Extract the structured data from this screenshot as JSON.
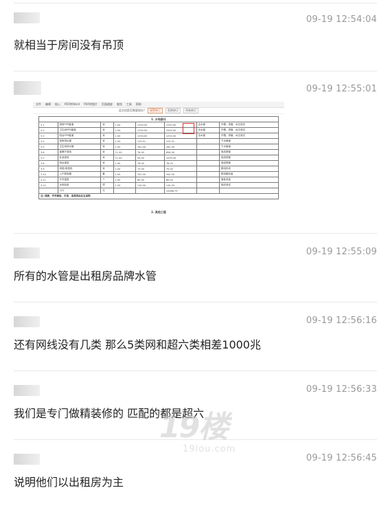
{
  "messages": [
    {
      "time": "09-19 12:54:04",
      "text": "就相当于房间没有吊顶"
    },
    {
      "time": "09-19 12:55:01",
      "text": ""
    },
    {
      "time": "09-19 12:55:09",
      "text": "所有的水管是出租房品牌水管"
    },
    {
      "time": "09-19 12:56:16",
      "text": "还有网线没有几类 那么5类网和超六类相差1000兆"
    },
    {
      "time": "09-19 12:56:33",
      "text": "我们是专门做精装修的 匹配的都是超六"
    },
    {
      "time": "09-19 12:56:45",
      "text": "说明他们以出租房为主"
    }
  ],
  "screenshot": {
    "toolbar": [
      "文件",
      "编辑",
      "插入",
      "PDF转Word",
      "PDF转图片",
      "页面缩放",
      "查找",
      "工具",
      "帮助"
    ],
    "notice_text": "此文档是否需要保存?",
    "notice_buttons": [
      "接受修订",
      "拒绝修订",
      "所有修订"
    ],
    "section_title": "1. 水电部分",
    "rows": [
      [
        "3.1",
        "厨房PPR管道",
        "米",
        "1.00",
        "1250.00",
        "1250.00",
        "全水管",
        "开槽、排管、水压测试"
      ],
      [
        "3.2",
        "卫生间PPR管道",
        "米",
        "2.00",
        "1250.00",
        "2500.00",
        "全水管",
        "开槽、排管、水压测试"
      ],
      [
        "3.3",
        "阳台PPR管道",
        "米",
        "1.00",
        "1250.00",
        "1250.00",
        "全水管",
        "开槽、排管、水压测试"
      ],
      [
        "3.4",
        "厨房排水管",
        "米",
        "1.00",
        "125.51",
        "125.51",
        "",
        "下水管道"
      ],
      [
        "3.5",
        "卫生间排水管",
        "米",
        "1.00",
        "161.00",
        "161.00",
        "",
        "下水管道"
      ],
      [
        "3.6",
        "客餐厅强电",
        "米",
        "11.00",
        "78.00",
        "858.00",
        "",
        "电线穿管"
      ],
      [
        "3.7",
        "卧室强电",
        "米",
        "11.00",
        "94.50",
        "1039.50",
        "",
        "电线穿管"
      ],
      [
        "3.8",
        "阳台强电",
        "米",
        "1.00",
        "78.00",
        "78.00",
        "",
        "电线穿管"
      ],
      [
        "3.9",
        "网络/电视线",
        "米",
        "1.00",
        "75.00",
        "75.00",
        "",
        "弱电布线"
      ],
      [
        "3.10",
        "入户配电箱",
        "套",
        "1.00",
        "342.00",
        "342.00",
        "",
        "配电箱安装"
      ],
      [
        "3.11",
        "开关插座",
        "个",
        "1.00",
        "80.00",
        "80.00",
        "",
        "面板安装"
      ],
      [
        "3.12",
        "水电验收",
        "项",
        "1.00",
        "145.00",
        "145.00",
        "",
        "验收测试"
      ],
      [
        "",
        "小计",
        "元",
        "",
        "",
        "12086.79",
        "",
        ""
      ]
    ],
    "note": "注: 插座、开关面板、灯具、洁具等由业主自购",
    "next_section": "2. 其他工程"
  },
  "watermark": {
    "big": "19楼",
    "small": "19lou.com"
  }
}
